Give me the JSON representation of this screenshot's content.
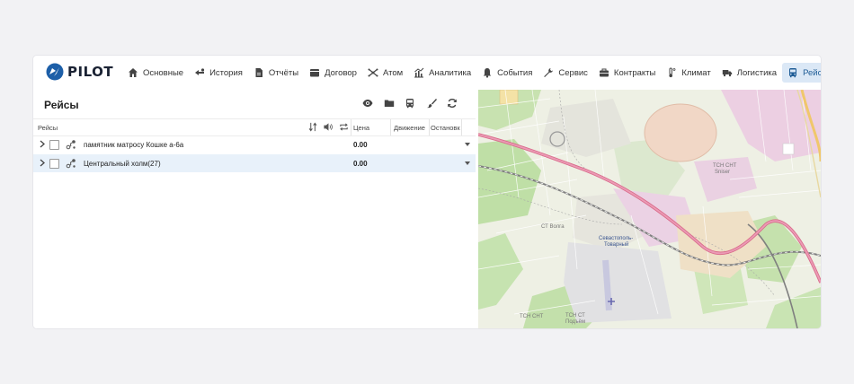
{
  "app": {
    "logo_text": "PILOT"
  },
  "nav": {
    "items": [
      {
        "id": "osnovnye",
        "label": "Основные",
        "icon": "home-icon",
        "active": false
      },
      {
        "id": "istoriya",
        "label": "История",
        "icon": "history-route-icon",
        "active": false
      },
      {
        "id": "otchety",
        "label": "Отчёты",
        "icon": "report-file-icon",
        "active": false
      },
      {
        "id": "dogovor",
        "label": "Договор",
        "icon": "contract-folder-icon",
        "active": false
      },
      {
        "id": "atom",
        "label": "Атом",
        "icon": "atom-icon",
        "active": false
      },
      {
        "id": "analitika",
        "label": "Аналитика",
        "icon": "analytics-chart-icon",
        "active": false
      },
      {
        "id": "sobytiya",
        "label": "События",
        "icon": "bell-icon",
        "active": false
      },
      {
        "id": "servis",
        "label": "Сервис",
        "icon": "wrench-icon",
        "active": false
      },
      {
        "id": "kontrakty",
        "label": "Контракты",
        "icon": "briefcase-icon",
        "active": false
      },
      {
        "id": "klimat",
        "label": "Климат",
        "icon": "thermometer-icon",
        "active": false
      },
      {
        "id": "logistika",
        "label": "Логистика",
        "icon": "truck-icon",
        "active": false
      },
      {
        "id": "reysy",
        "label": "Рейсы",
        "icon": "bus-icon",
        "active": true
      }
    ]
  },
  "panel": {
    "title": "Рейсы",
    "tools": [
      "eye-icon",
      "folder-icon",
      "bus-icon",
      "brush-icon",
      "refresh-icon"
    ],
    "columns": {
      "name": "Рейсы",
      "price": "Цена",
      "movement": "Движение",
      "stops": "Остановк"
    },
    "rows": [
      {
        "name": "памятник матросу Кошке а-6а",
        "price": "0.00",
        "selected": false
      },
      {
        "name": "Центральный холм(27)",
        "price": "0.00",
        "selected": true
      }
    ]
  },
  "map": {
    "labels": {
      "station": "Севастополь-",
      "station2": "Товарный",
      "tsn1": "ТСН СНТ",
      "tsn1b": "Sniser",
      "tsn2": "ТСН СНТ",
      "tsn3": "ТСН СТ",
      "tsn3b": "Подъём",
      "tsn4": "СТ Волга"
    }
  }
}
